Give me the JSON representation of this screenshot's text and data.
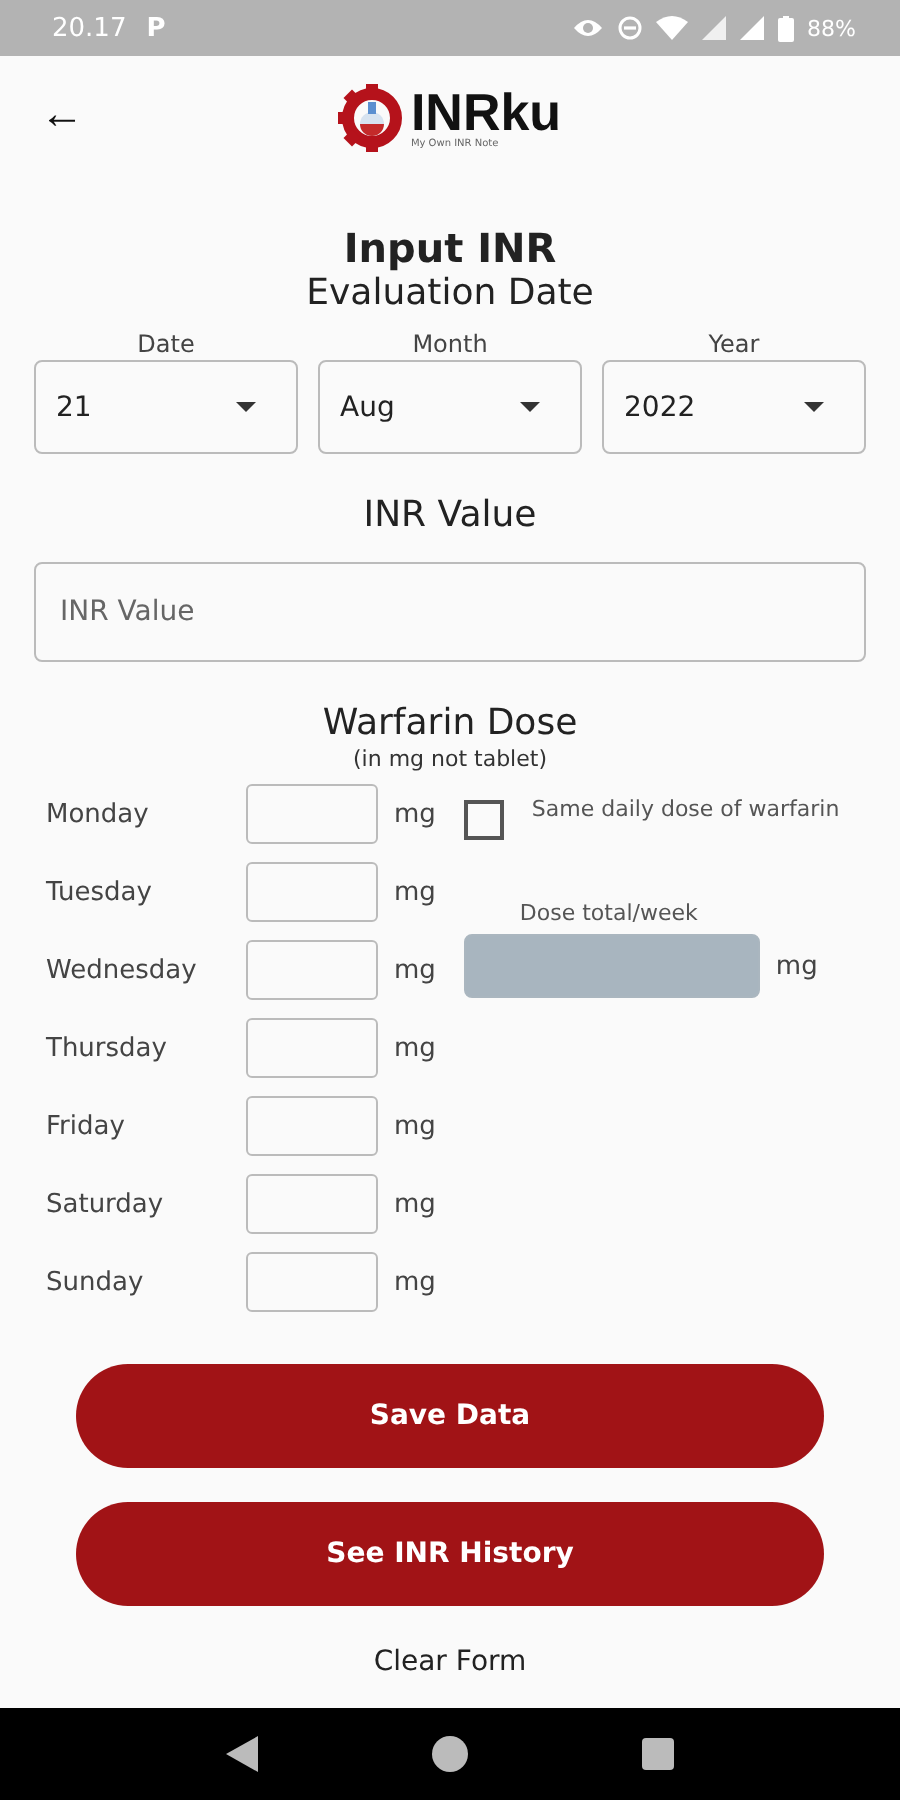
{
  "status_bar": {
    "time": "20.17",
    "app_glyph": "P",
    "battery": "88%"
  },
  "header": {
    "back": "←",
    "logo": "INRku",
    "tagline": "My Own INR Note"
  },
  "title": "Input INR",
  "evaluation_date": {
    "heading": "Evaluation Date",
    "dropdowns": [
      {
        "label": "Date",
        "value": "21"
      },
      {
        "label": "Month",
        "value": "Aug"
      },
      {
        "label": "Year",
        "value": "2022"
      }
    ]
  },
  "inr": {
    "heading": "INR Value",
    "placeholder": "INR Value"
  },
  "warfarin": {
    "heading": "Warfarin Dose",
    "subheading": "(in mg not tablet)",
    "days": [
      {
        "day": "Monday",
        "unit": "mg"
      },
      {
        "day": "Tuesday",
        "unit": "mg"
      },
      {
        "day": "Wednesday",
        "unit": "mg"
      },
      {
        "day": "Thursday",
        "unit": "mg"
      },
      {
        "day": "Friday",
        "unit": "mg"
      },
      {
        "day": "Saturday",
        "unit": "mg"
      },
      {
        "day": "Sunday",
        "unit": "mg"
      }
    ],
    "same_dose": {
      "label": "Same daily dose of warfarin",
      "checked": false
    },
    "total": {
      "label": "Dose total/week",
      "unit": "mg",
      "disabled": true
    }
  },
  "buttons": [
    "Save Data",
    "See INR History"
  ],
  "clear_link": "Clear Form"
}
